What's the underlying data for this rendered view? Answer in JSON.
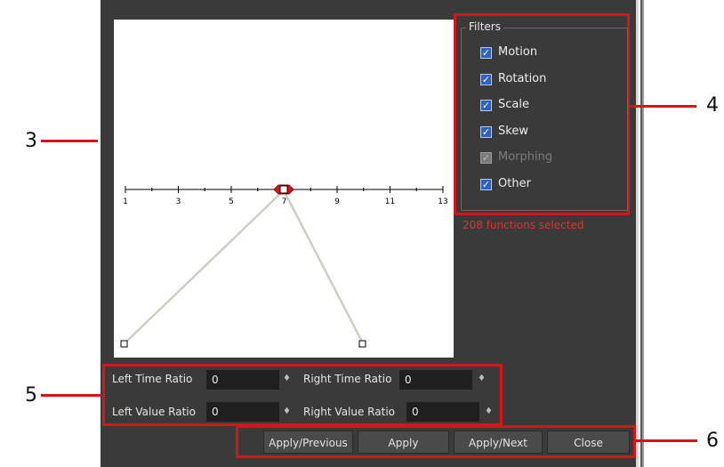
{
  "callouts": {
    "c3": "3",
    "c4": "4",
    "c5": "5",
    "c6": "6"
  },
  "timeline": {
    "ticks": [
      "1",
      "3",
      "5",
      "7",
      "9",
      "11",
      "13"
    ]
  },
  "filters": {
    "legend": "Filters",
    "items": [
      {
        "label": "Motion",
        "checked": true,
        "enabled": true
      },
      {
        "label": "Rotation",
        "checked": true,
        "enabled": true
      },
      {
        "label": "Scale",
        "checked": true,
        "enabled": true
      },
      {
        "label": "Skew",
        "checked": true,
        "enabled": true
      },
      {
        "label": "Morphing",
        "checked": true,
        "enabled": false
      },
      {
        "label": "Other",
        "checked": true,
        "enabled": true
      }
    ],
    "status": "208 functions selected"
  },
  "params": {
    "left_time_label": "Left Time Ratio",
    "left_time_value": "0",
    "right_time_label": "Right Time Ratio",
    "right_time_value": "0",
    "left_value_label": "Left Value Ratio",
    "left_value_value": "0",
    "right_value_label": "Right Value Ratio",
    "right_value_value": "0",
    "spinner_glyph": "♦"
  },
  "buttons": {
    "apply_previous": "Apply/Previous",
    "apply": "Apply",
    "apply_next": "Apply/Next",
    "close": "Close"
  },
  "colors": {
    "panel": "#3a3a3a",
    "highlight": "#d8141b",
    "status": "#e0322c",
    "checkbox": "#2b62c4"
  }
}
